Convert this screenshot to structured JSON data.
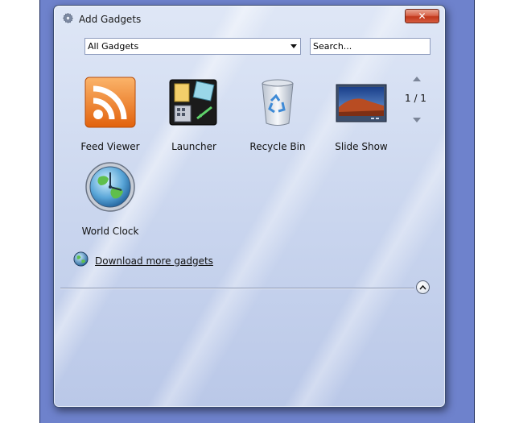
{
  "window": {
    "title": "Add Gadgets",
    "close_label": "✕"
  },
  "toolbar": {
    "filter_selected": "All Gadgets",
    "search_placeholder": "Search..."
  },
  "gadgets": [
    {
      "label": "Feed Viewer",
      "icon": "rss-feed-icon"
    },
    {
      "label": "Launcher",
      "icon": "launcher-icon"
    },
    {
      "label": "Recycle Bin",
      "icon": "recycle-bin-icon"
    },
    {
      "label": "Slide Show",
      "icon": "slideshow-icon"
    },
    {
      "label": "World Clock",
      "icon": "world-clock-icon"
    }
  ],
  "pager": {
    "text": "1 / 1"
  },
  "footer": {
    "download_link": "Download more gadgets"
  },
  "colors": {
    "desktop": "#6e82cc",
    "rss_orange": "#f07a1f",
    "close_red": "#c1381b"
  }
}
